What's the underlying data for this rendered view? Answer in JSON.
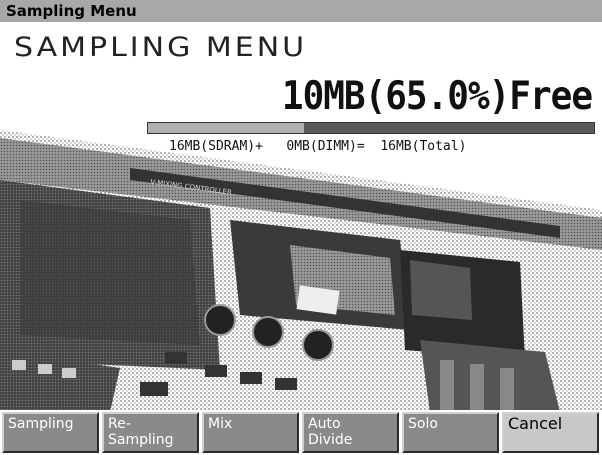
{
  "window": {
    "title": "Sampling Menu"
  },
  "header": {
    "big_title": "SAMPLING MENU"
  },
  "memory": {
    "free_text": "10MB(65.0%)Free",
    "free_fraction": 0.35,
    "breakdown": "16MB(SDRAM)+   0MB(DIMM)=  16MB(Total)"
  },
  "photo": {
    "description_label": "sampler-controller-photo",
    "panel_text": "V-MIXING CONTROLLER"
  },
  "function_keys": [
    {
      "label": "Sampling"
    },
    {
      "label": "Re-\nSampling"
    },
    {
      "label": "Mix"
    },
    {
      "label": "Auto\nDivide"
    },
    {
      "label": "Solo"
    },
    {
      "label": "Cancel"
    }
  ]
}
